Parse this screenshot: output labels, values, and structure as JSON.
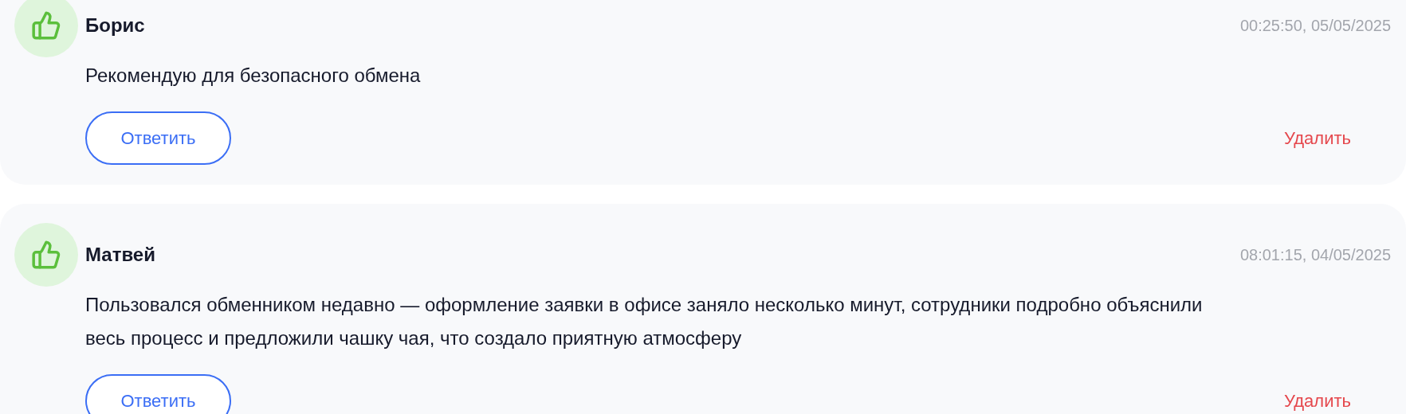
{
  "reviews": [
    {
      "author": "Борис",
      "time": "00:25:50, 05/05/2025",
      "text": "Рекомендую для безопасного обмена",
      "reply": "Ответить",
      "delete": "Удалить"
    },
    {
      "author": "Матвей",
      "time": "08:01:15, 04/05/2025",
      "text": "Пользовался обменником недавно — оформление заявки в офисе заняло несколько минут, сотрудники подробно объяснили весь процесс и предложили чашку чая, что создало приятную атмосферу",
      "reply": "Ответить",
      "delete": "Удалить"
    }
  ]
}
